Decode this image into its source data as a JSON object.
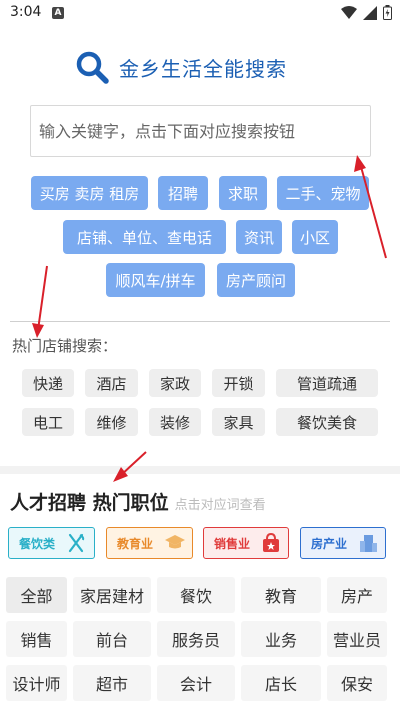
{
  "status_bar": {
    "time": "3:04",
    "notif_glyph": "A"
  },
  "search": {
    "title": "金乡生活全能搜索",
    "placeholder": "输入关键字，点击下面对应搜索按钮"
  },
  "categories": [
    "买房 卖房 租房",
    "招聘",
    "求职",
    "二手、宠物",
    "店铺、单位、查电话",
    "资讯",
    "小区",
    "顺风车/拼车",
    "房产顾问"
  ],
  "hot_shops": {
    "title": "热门店铺搜索：",
    "tags": [
      "快递",
      "酒店",
      "家政",
      "开锁",
      "管道疏通",
      "电工",
      "维修",
      "装修",
      "家具",
      "餐饮美食"
    ]
  },
  "jobs": {
    "title": "人才招聘 热门职位",
    "subtitle": "点击对应词查看",
    "categories": [
      {
        "label": "餐饮类",
        "color": "#2ab0c8",
        "bg": "#e9f8fb",
        "icon": "utensils-icon"
      },
      {
        "label": "教育业",
        "color": "#e8892a",
        "bg": "#fff3e3",
        "icon": "graduation-cap-icon"
      },
      {
        "label": "销售业",
        "color": "#e03b3b",
        "bg": "#fdecec",
        "icon": "shopping-bag-icon"
      },
      {
        "label": "房产业",
        "color": "#2d6fcf",
        "bg": "#eaf1fc",
        "icon": "building-icon"
      }
    ],
    "grid": [
      "全部",
      "家居建材",
      "餐饮",
      "教育",
      "房产",
      "销售",
      "前台",
      "服务员",
      "业务",
      "营业员",
      "设计师",
      "超市",
      "会计",
      "店长",
      "保安"
    ]
  },
  "colors": {
    "accent": "#1b5fb3",
    "button": "#7aaaf0",
    "arrow": "#d9202a"
  }
}
